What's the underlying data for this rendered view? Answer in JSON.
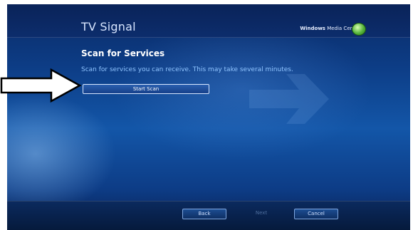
{
  "window": {
    "title": "TV Signal"
  },
  "brand": {
    "name_bold": "Windows",
    "name_light": "Media Center"
  },
  "section": {
    "title": "Scan for Services",
    "description": "Scan for services you can receive. This may take several minutes."
  },
  "actions": {
    "start_scan": "Start Scan"
  },
  "navigation": {
    "back": "Back",
    "next": "Next",
    "cancel": "Cancel"
  },
  "colors": {
    "background_top": "#0a2a66",
    "background_mid": "#1356a8",
    "description_text": "#8fc4ff",
    "logo_green": "#55b33a"
  },
  "icons": [
    "windows-media-center-logo-icon",
    "background-arrow-icon",
    "callout-arrow-icon"
  ]
}
